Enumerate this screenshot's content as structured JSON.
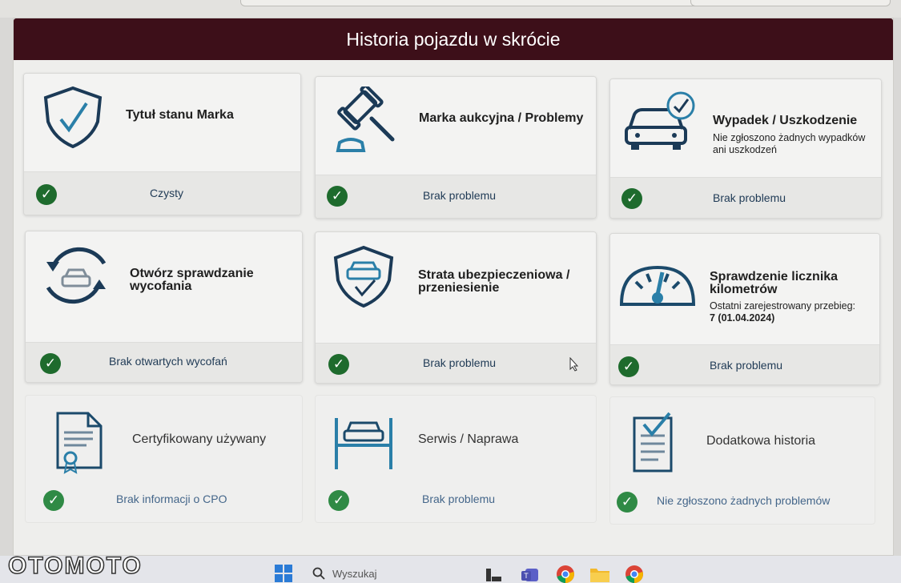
{
  "banner_title": "Historia pojazdu w skrócie",
  "cards": [
    {
      "title": "Tytuł stanu Marka",
      "status": "Czysty",
      "icon": "shield-check-icon"
    },
    {
      "title": "Marka aukcyjna / Problemy",
      "status": "Brak problemu",
      "icon": "gavel-icon"
    },
    {
      "title": "Wypadek / Uszkodzenie",
      "subtitle_line1": "Nie zgłoszono żadnych wypadków",
      "subtitle_line2": "ani uszkodzeń",
      "status": "Brak problemu",
      "icon": "car-check-icon"
    },
    {
      "title_line1": "Otwórz sprawdzanie",
      "title_line2": "wycofania",
      "status": "Brak otwartych wycofań",
      "icon": "car-cycle-icon"
    },
    {
      "title_line1": "Strata ubezpieczeniowa /",
      "title_line2": "przeniesienie",
      "status": "Brak problemu",
      "icon": "shield-car-icon"
    },
    {
      "title_line1": "Sprawdzenie licznika",
      "title_line2": "kilometrów",
      "subtitle_line1": "Ostatni zarejestrowany przebieg:",
      "subtitle_line2": "7 (01.04.2024)",
      "status": "Brak problemu",
      "icon": "gauge-icon"
    },
    {
      "title": "Certyfikowany używany",
      "status": "Brak informacji o CPO",
      "icon": "certificate-icon"
    },
    {
      "title": "Serwis / Naprawa",
      "status": "Brak problemu",
      "icon": "car-lift-icon"
    },
    {
      "title": "Dodatkowa historia",
      "status": "Nie zgłoszono żadnych problemów",
      "icon": "document-check-icon"
    }
  ],
  "taskbar": {
    "search_placeholder": "Wyszukaj",
    "icons": [
      "windows-start-icon",
      "search-icon",
      "task-view-icon",
      "teams-icon",
      "chrome-icon",
      "file-explorer-icon",
      "chrome-icon"
    ]
  },
  "watermark": "OTOMOTO",
  "colors": {
    "banner": "#3d0f19",
    "check": "#1e6b2d",
    "icon": "#1b4a6b",
    "accent_teal": "#2a7fa8"
  }
}
